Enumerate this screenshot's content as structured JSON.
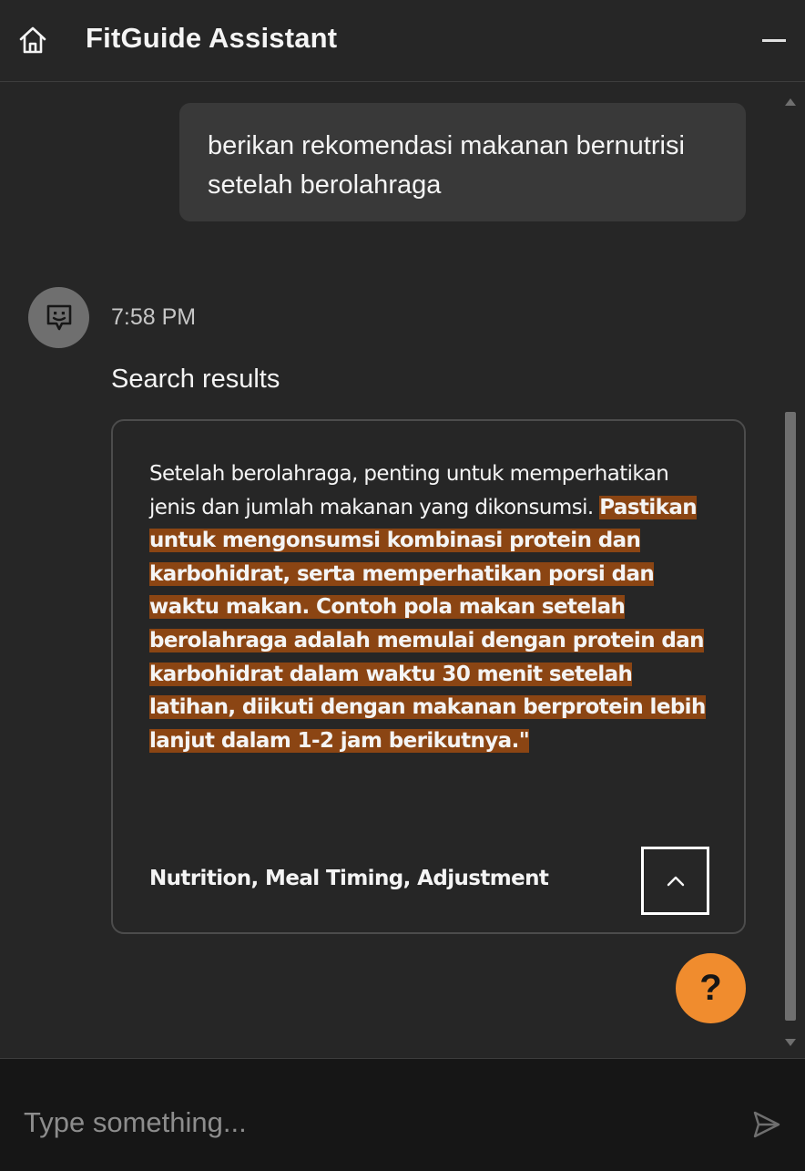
{
  "header": {
    "title": "FitGuide Assistant",
    "home_icon": "home-icon",
    "minimize_icon": "minimize-icon"
  },
  "conversation": {
    "user_message": "berikan rekomendasi makanan bernutrisi setelah berolahraga",
    "bot": {
      "avatar_icon": "chat-bot-icon",
      "timestamp": "7:58 PM",
      "section_heading": "Search results",
      "result": {
        "text_plain": "Setelah berolahraga, penting untuk memperhatikan jenis dan jumlah makanan yang dikonsumsi. ",
        "text_highlighted": "Pastikan untuk mengonsumsi kombinasi protein dan karbohidrat, serta memperhatikan porsi dan waktu makan. Contoh pola makan setelah berolahraga adalah memulai dengan protein dan karbohidrat dalam waktu 30 menit setelah latihan, diikuti dengan makanan berprotein lebih lanjut dalam 1-2 jam berikutnya.\"",
        "tags": "Nutrition, Meal Timing, Adjustment",
        "collapse_icon": "chevron-up-icon"
      }
    }
  },
  "help_button": {
    "label": "?"
  },
  "composer": {
    "placeholder": "Type something...",
    "send_icon": "send-icon"
  },
  "colors": {
    "background": "#262626",
    "bubble": "#393939",
    "highlight": "#8b4513",
    "accent": "#f08c2e",
    "input_bar": "#161616"
  }
}
